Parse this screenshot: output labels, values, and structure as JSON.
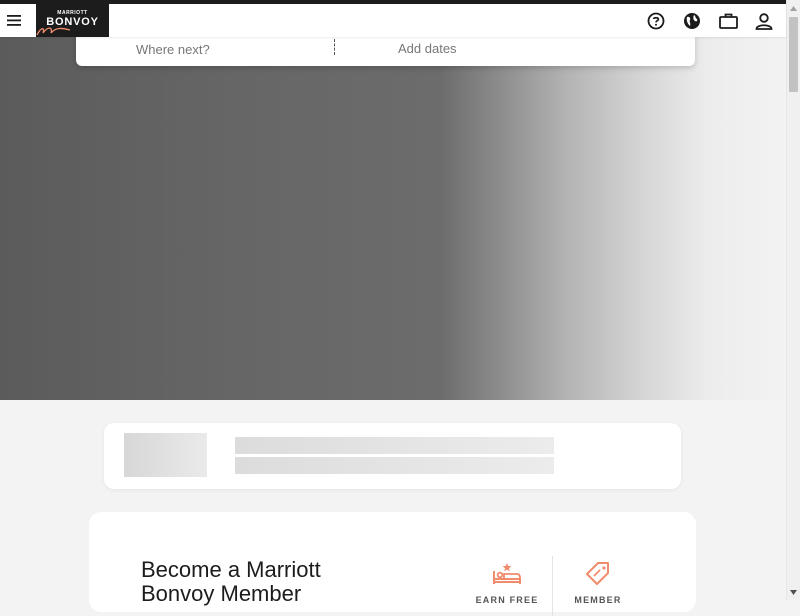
{
  "header": {
    "logo": {
      "small_text": "MARRIOTT",
      "main_text": "BONVOY"
    },
    "icons": [
      "menu-icon",
      "help-icon",
      "globe-icon",
      "briefcase-icon",
      "user-icon"
    ]
  },
  "search": {
    "destination_placeholder": "Where next?",
    "dates_label": "Add dates"
  },
  "member": {
    "title": "Become a Marriott Bonvoy Member",
    "benefits": [
      {
        "label": "EARN FREE",
        "icon": "bed-star-icon"
      },
      {
        "label": "MEMBER",
        "icon": "tag-icon"
      }
    ]
  },
  "colors": {
    "brand_dark": "#1c1c1c",
    "accent": "#f08b6c",
    "background": "#f3f3f3"
  }
}
